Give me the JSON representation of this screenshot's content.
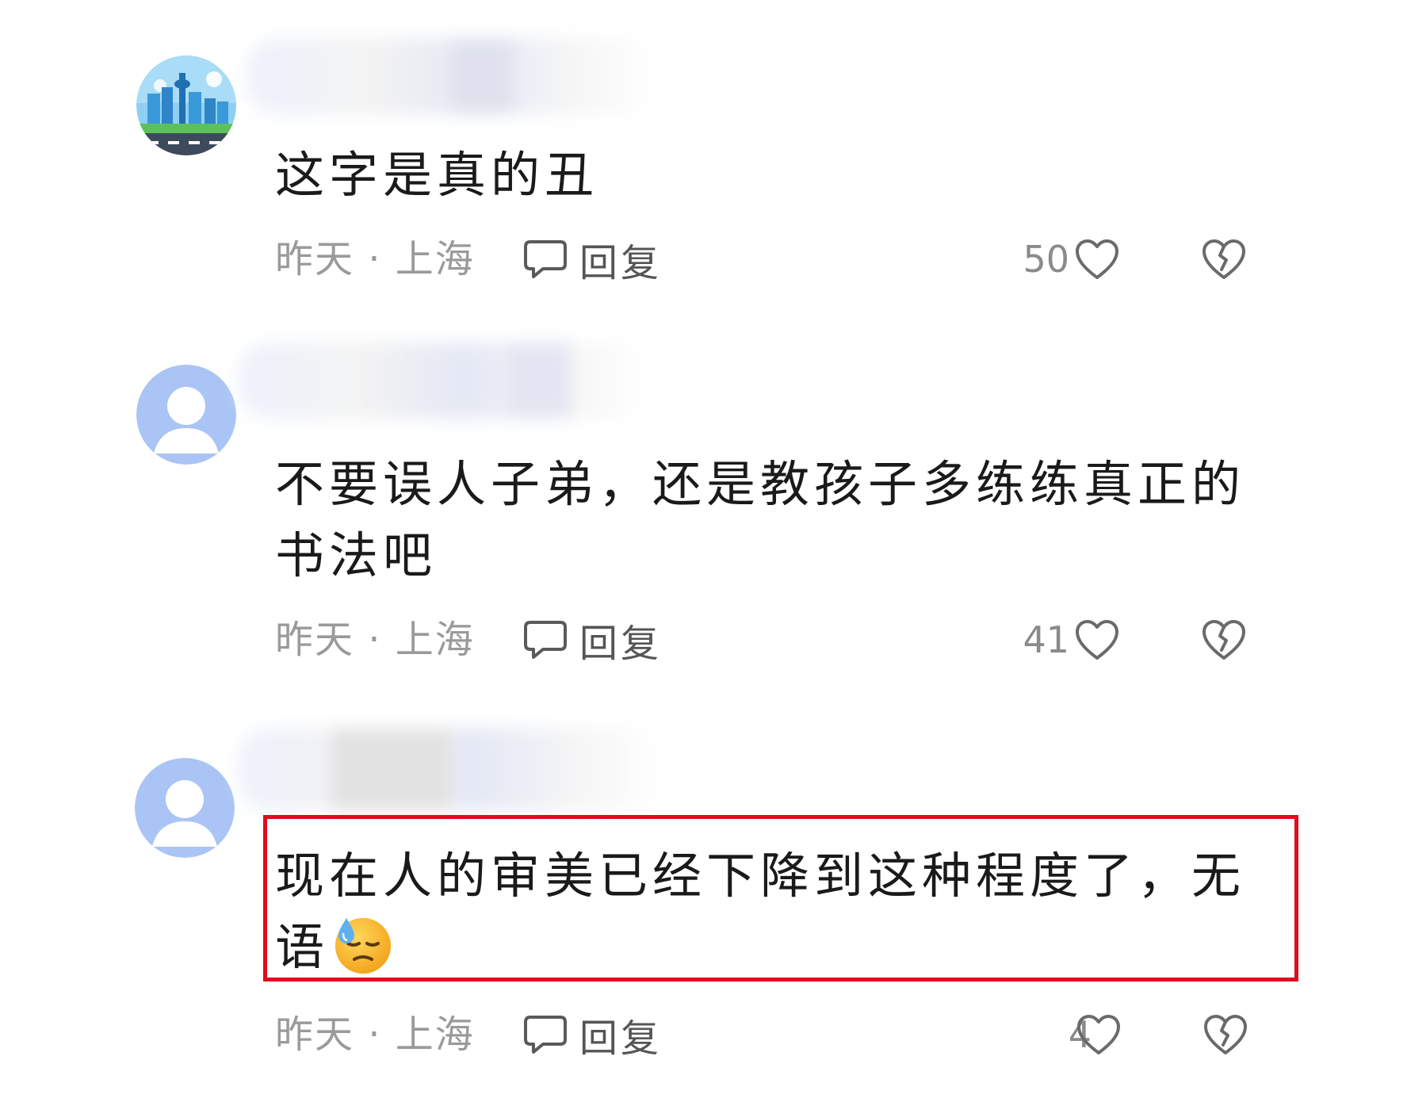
{
  "comments": [
    {
      "avatar": "city-skyline-avatar",
      "text": "这字是真的丑",
      "time_location": "昨天 · 上海",
      "reply_label": "回复",
      "likes": "50"
    },
    {
      "avatar": "default-user-avatar",
      "text": "不要误人子弟，还是教孩子多练练真正的书法吧",
      "time_location": "昨天 · 上海",
      "reply_label": "回复",
      "likes": "41"
    },
    {
      "avatar": "default-user-avatar",
      "text": "现在人的审美已经下降到这种程度了，无语",
      "emoji": "downcast-sweat-face",
      "time_location": "昨天 · 上海",
      "reply_label": "回复",
      "likes": "4",
      "highlighted": true
    }
  ],
  "colors": {
    "highlight_border": "#e10a1e",
    "meta_text": "#9a9a9a",
    "body_text": "#1a1a1a",
    "avatar_blue": "#aac4f5"
  },
  "icons": {
    "reply": "speech-bubble-icon",
    "like": "heart-outline-icon",
    "dislike": "broken-heart-icon"
  }
}
